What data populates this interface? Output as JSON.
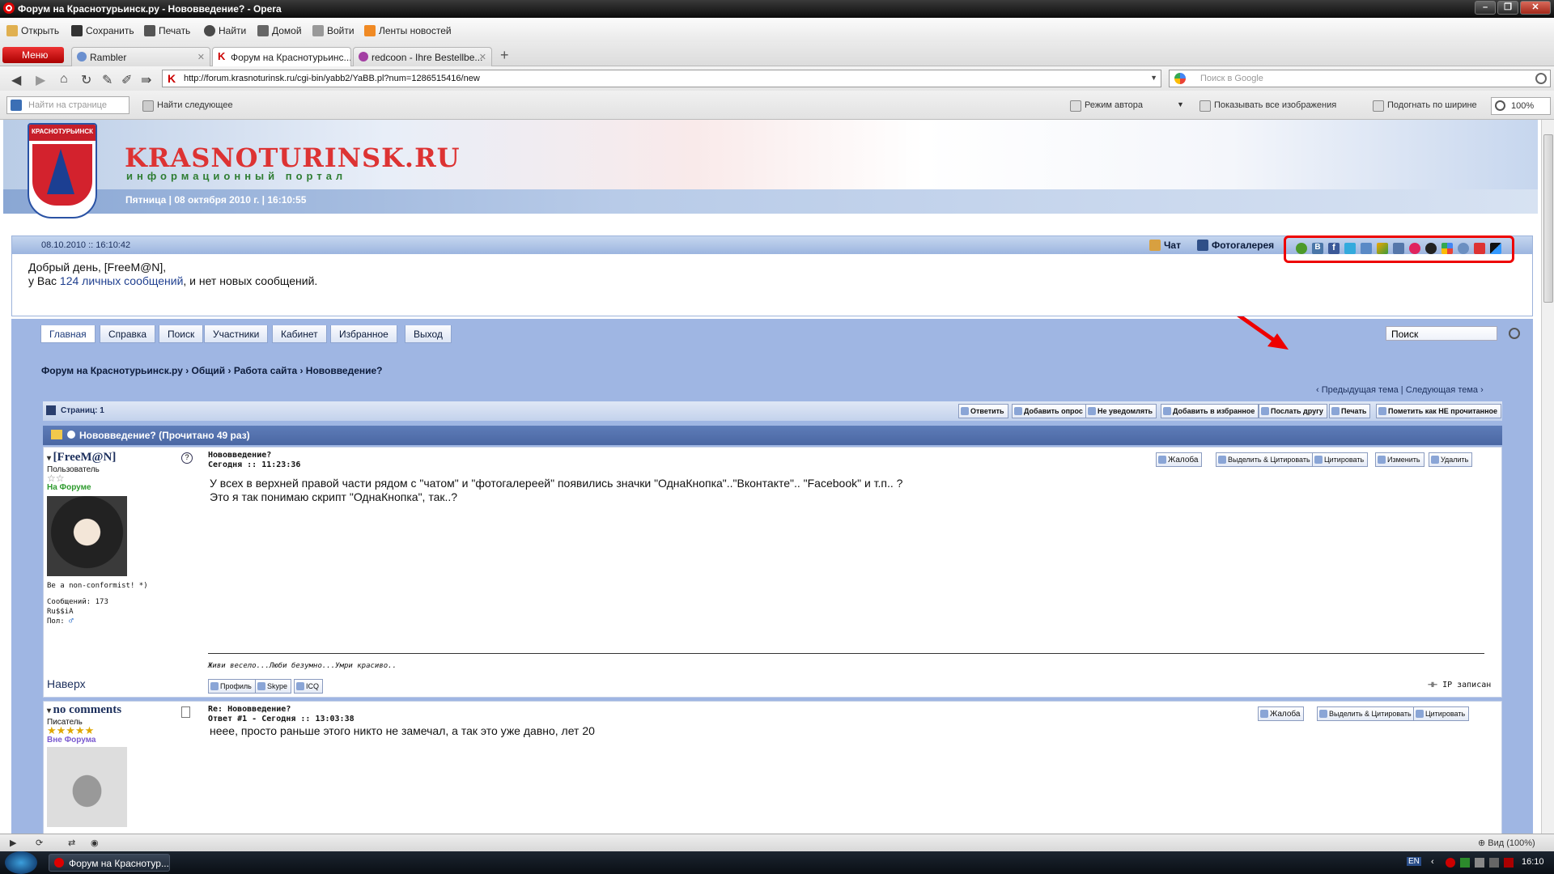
{
  "window": {
    "title": "Форум на Краснотурьинск.ру - Нововведение? - Opera"
  },
  "menubar": {
    "open": "Открыть",
    "save": "Сохранить",
    "print": "Печать",
    "find": "Найти",
    "home": "Домой",
    "login": "Войти",
    "feeds": "Ленты новостей"
  },
  "tabs": {
    "menu": "Меню",
    "items": [
      "Rambler",
      "Форум на Краснотурьинс...",
      "redcoon - Ihre Bestellbe..."
    ]
  },
  "address": {
    "url": "http://forum.krasnoturinsk.ru/cgi-bin/yabb2/YaBB.pl?num=1286515416/new",
    "search_placeholder": "Поиск в Google"
  },
  "findbar": {
    "placeholder": "Найти на странице",
    "find_next": "Найти следующее",
    "author_mode": "Режим автора",
    "show_images": "Показывать все изображения",
    "fit_width": "Подогнать по ширине",
    "zoom": "100%"
  },
  "site": {
    "crest_label": "КРАСНОТУРЬИНСК",
    "name": "KRASNOTURINSK.RU",
    "subtitle": "информационный портал",
    "date": "Пятница | 08 октября 2010 г. | 16:10:55"
  },
  "userpanel": {
    "datetime": "08.10.2010 :: 16:10:42",
    "chat": "Чат",
    "gallery": "Фотогалерея",
    "greeting": "Добрый день, [FreeM@N],",
    "msg_prefix": "у Вас ",
    "msg_link": "124 личных сообщений",
    "msg_suffix": ", и нет новых сообщений."
  },
  "nav": {
    "items": [
      "Главная",
      "Справка",
      "Поиск",
      "Участники",
      "Кабинет",
      "Избранное",
      "Выход"
    ],
    "search": "Поиск"
  },
  "breadcrumb": "Форум на Краснотурьинск.ру › Общий › Работа сайта › Нововведение?",
  "prevnext": "‹ Предыдущая тема | Следующая тема ›",
  "pagesbar": {
    "pages": "Страниц: 1",
    "buttons": [
      "Ответить",
      "Добавить опрос",
      "Не уведомлять",
      "Добавить в избранное",
      "Послать другу",
      "Печать",
      "Пометить как НЕ прочитанное"
    ]
  },
  "topic": {
    "title": "Нововведение? (Прочитано 49 раз)"
  },
  "post1": {
    "author": "[FreeM@N]",
    "role": "Пользователь",
    "status": "На Форуме",
    "tagline": "Be a non-conformist! *)",
    "messages": "Сообщений: 173",
    "location": "Ru$$iA",
    "gender": "Пол:",
    "title": "Нововведение?",
    "date": "Сегодня :: 11:23:36",
    "actions": [
      "Жалоба",
      "Выделить & Цитировать",
      "Цитировать",
      "Изменить",
      "Удалить"
    ],
    "body1": "У всех  в верхней правой части рядом с \"чатом\" и \"фотогалереей\" появились значки \"ОднаКнопка\"..\"Вконтакте\".. \"Facebook\" и т.п.. ?",
    "body2": "Это я так понимаю скрипт \"ОднаКнопка\", так..?",
    "signature": "Живи весело...Люби безумно...Умри красиво..",
    "top": "Наверх",
    "profile": "Профиль",
    "skype": "Skype",
    "icq": "ICQ",
    "ip": "IP записан"
  },
  "post2": {
    "author": "no comments",
    "role": "Писатель",
    "status": "Вне Форума",
    "title": "Re: Нововведение?",
    "date": "Ответ #1 - Сегодня :: 13:03:38",
    "actions": [
      "Жалоба",
      "Выделить & Цитировать",
      "Цитировать"
    ],
    "body": "неее, просто раньше этого никто не замечал, а так это уже давно, лет 20"
  },
  "statusbar": {
    "zoom": "Вид (100%)"
  },
  "taskbar": {
    "item": "Форум на Краснотур...",
    "lang": "EN",
    "time": "16:10"
  }
}
